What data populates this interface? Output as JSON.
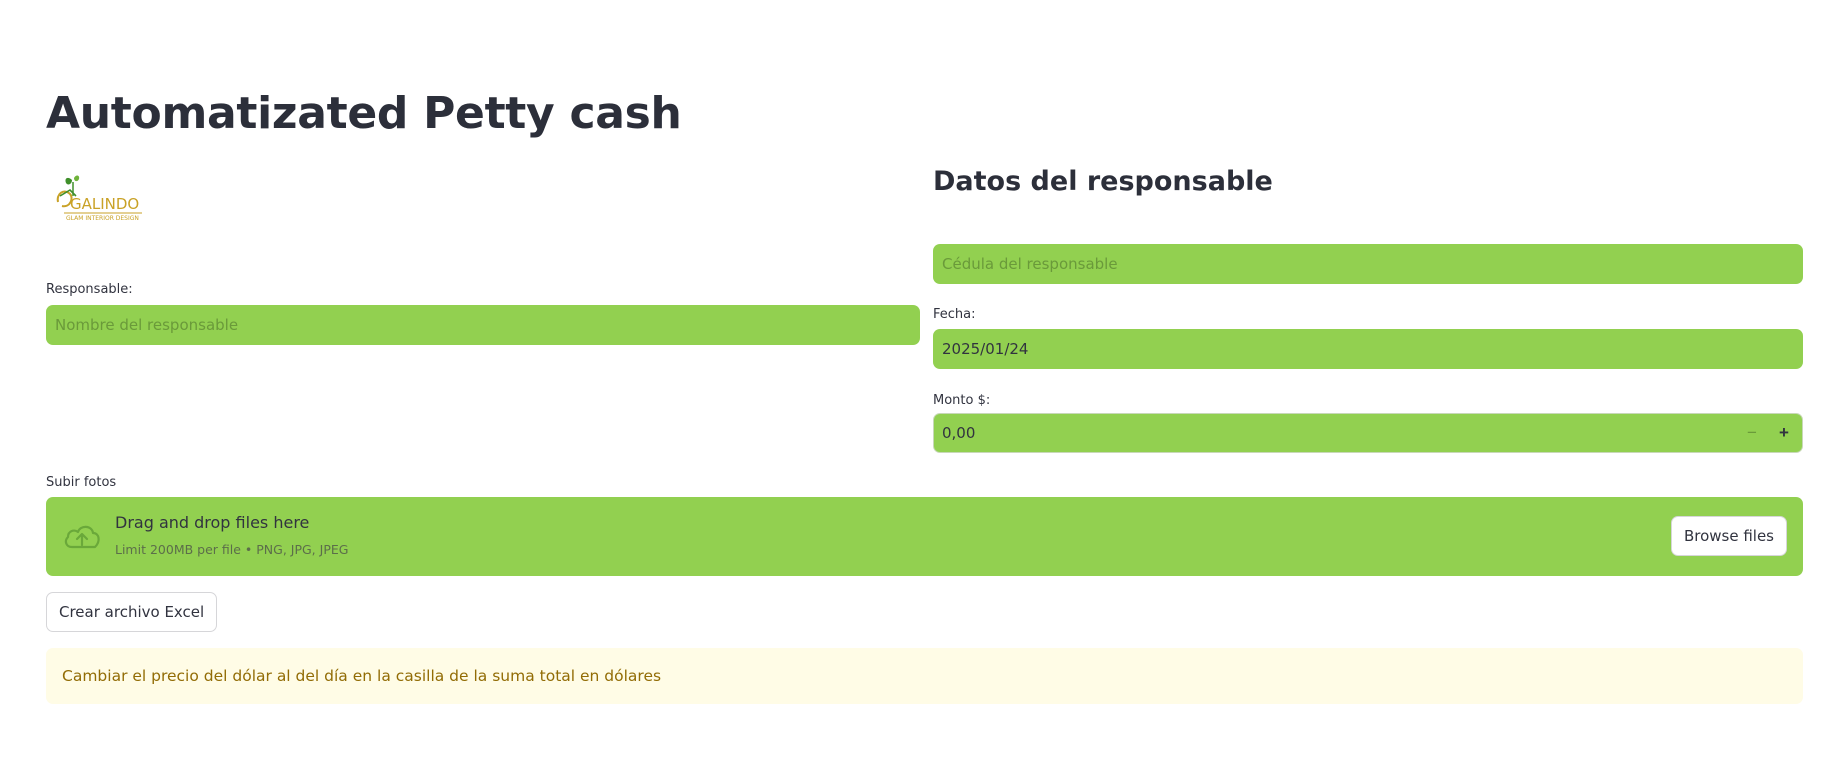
{
  "title": "Automatizated Petty cash",
  "logo": {
    "name": "GALINDO",
    "tagline": "GLAM INTERIOR DESIGN",
    "colors": {
      "gold": "#c9a227",
      "green": "#3f8f2a"
    }
  },
  "left": {
    "responsable_label": "Responsable:",
    "responsable_placeholder": "Nombre del responsable"
  },
  "right": {
    "section_title": "Datos del responsable",
    "cedula_placeholder": "Cédula del responsable",
    "fecha_label": "Fecha:",
    "fecha_value": "2025/01/24",
    "monto_label": "Monto $:",
    "monto_value": "0,00",
    "minus_symbol": "−",
    "plus_symbol": "+"
  },
  "upload": {
    "label": "Subir fotos",
    "title": "Drag and drop files here",
    "subtitle": "Limit 200MB per file • PNG, JPG, JPEG",
    "browse_label": "Browse files",
    "icon": "cloud-upload-icon"
  },
  "excel_button": "Crear archivo Excel",
  "alert_text": "Cambiar el precio del dólar al del día en la casilla de la suma total en dólares",
  "colors": {
    "field_bg": "#92d050",
    "alert_bg": "#fffce6",
    "alert_text": "#926c05",
    "heading": "#2c2f3a"
  }
}
